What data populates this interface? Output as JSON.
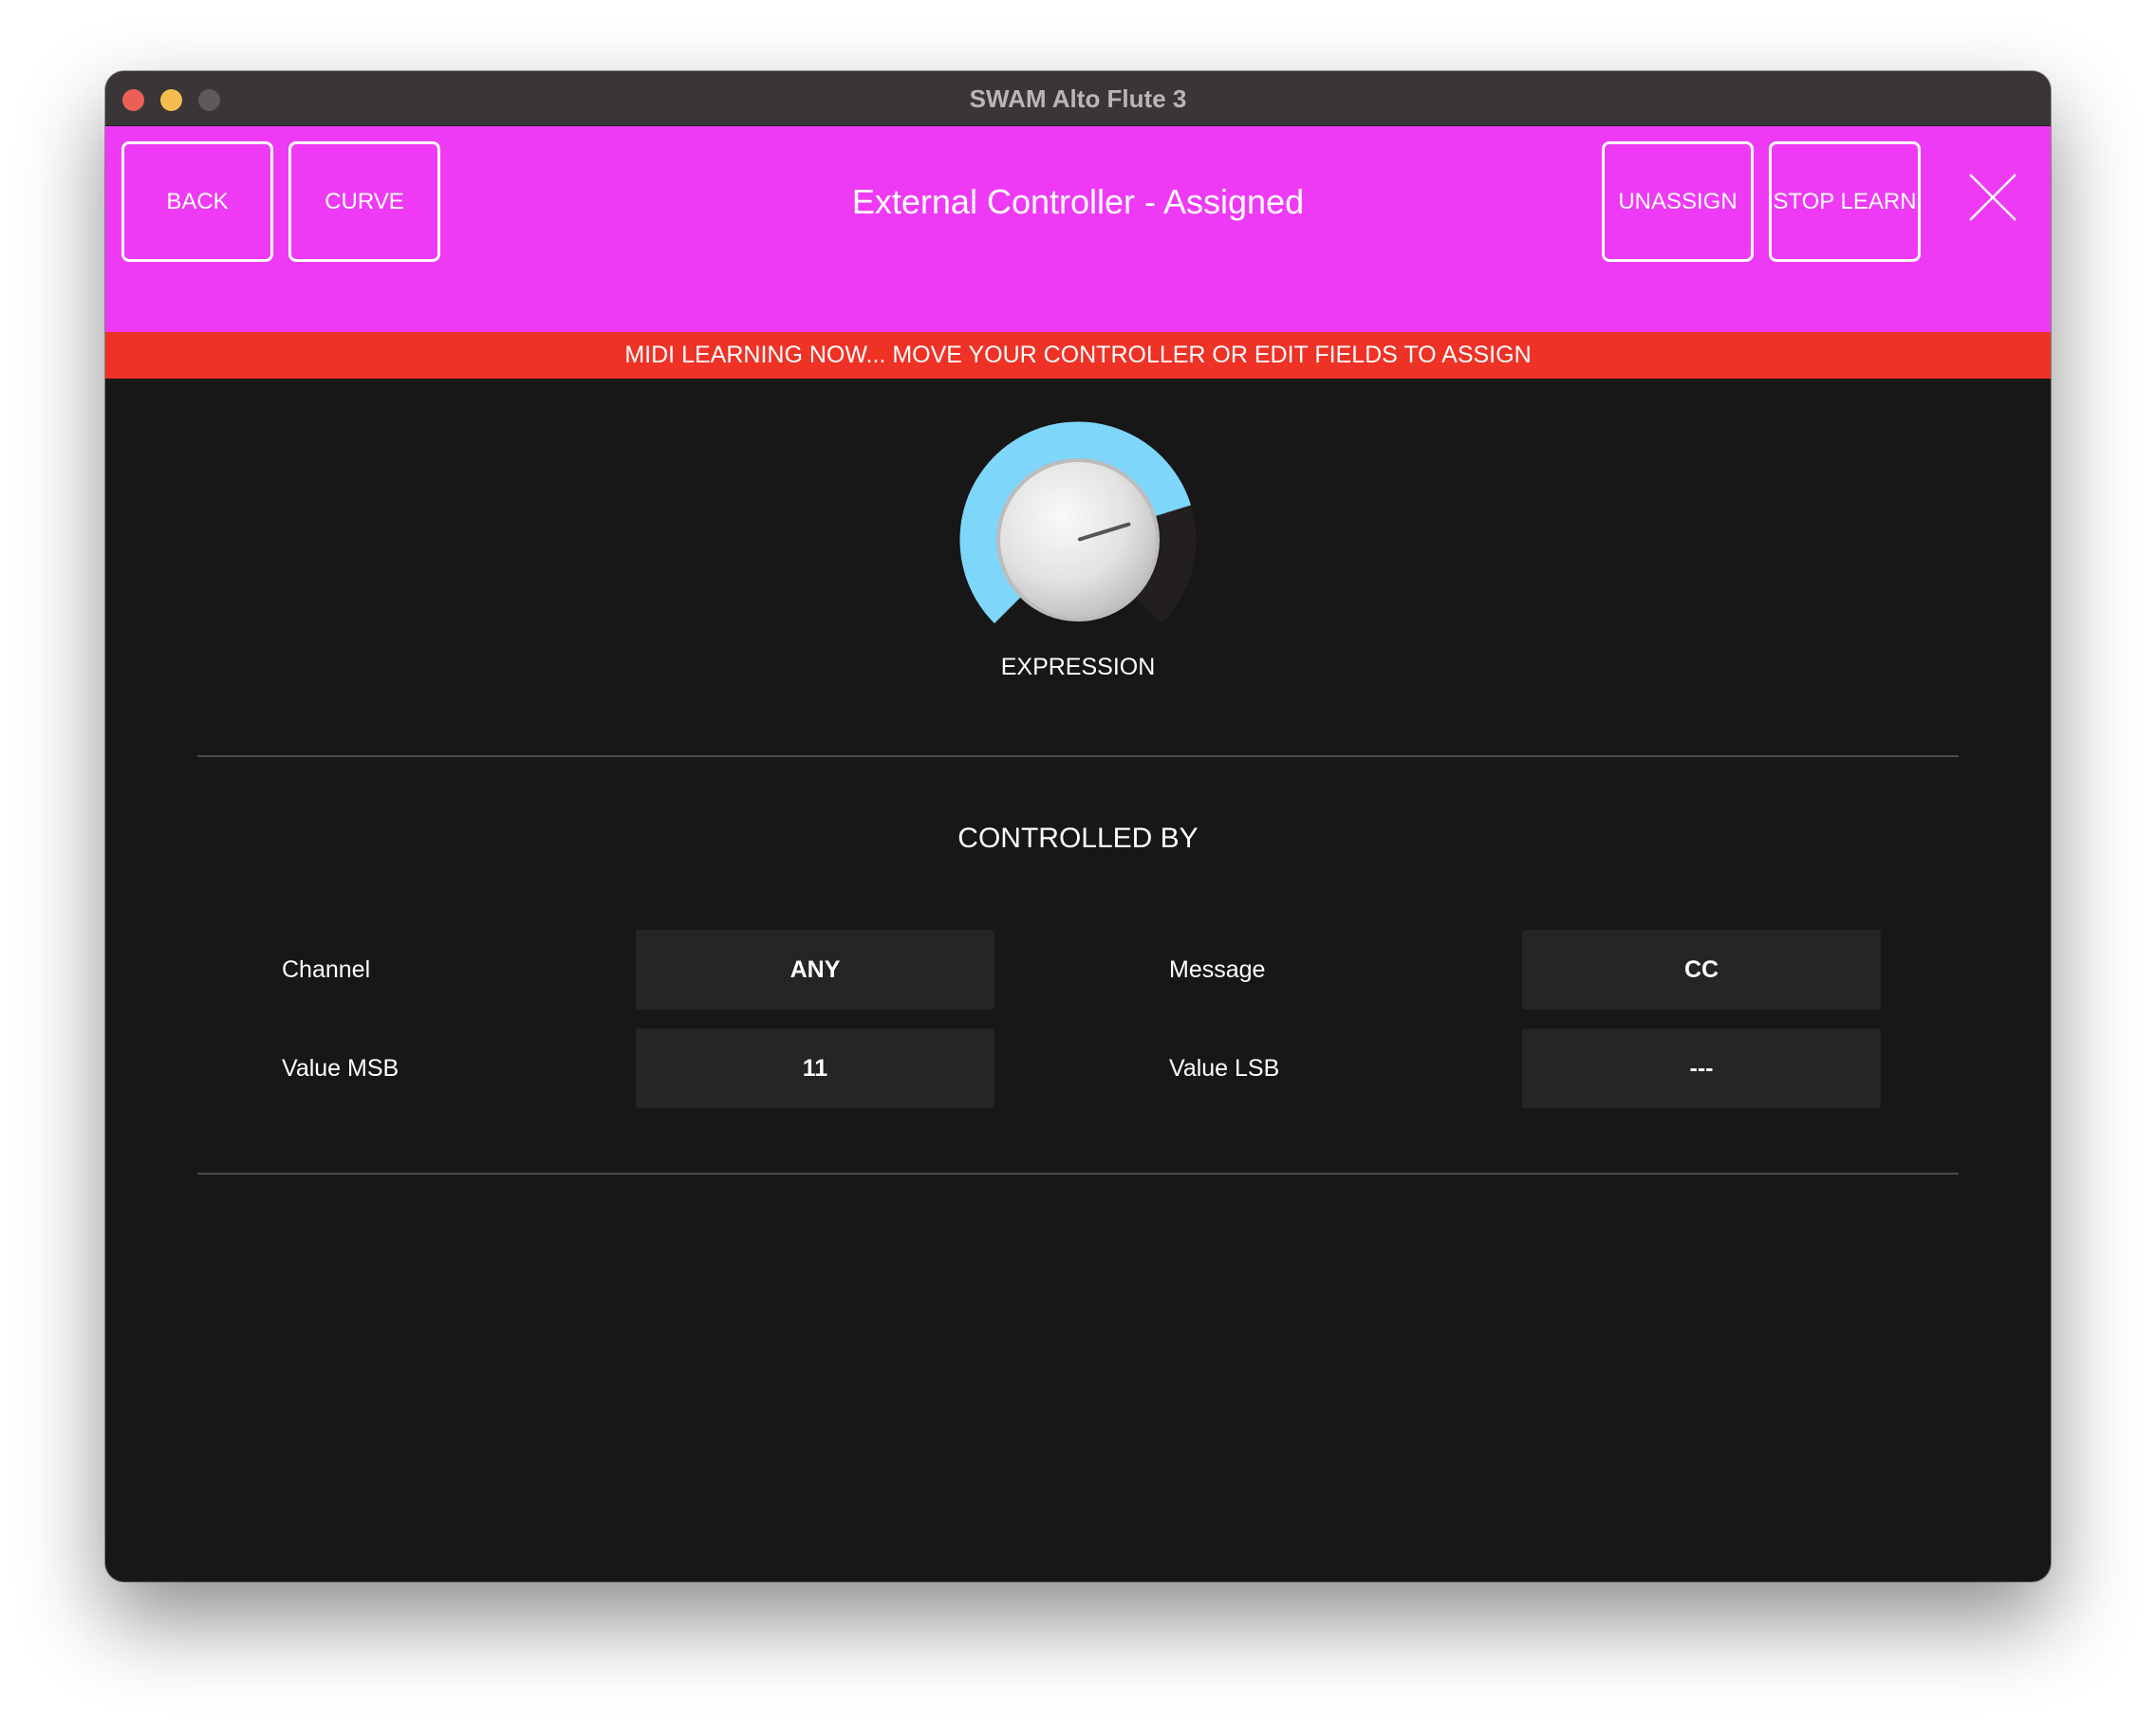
{
  "window": {
    "title": "SWAM Alto Flute 3"
  },
  "header": {
    "back_label": "BACK",
    "curve_label": "CURVE",
    "title": "External Controller - Assigned",
    "unassign_label": "UNASSIGN",
    "stop_learn_label": "STOP LEARN",
    "close_icon": "close-icon",
    "color": "#ee3af5"
  },
  "banner": {
    "text": "MIDI LEARNING NOW... MOVE YOUR CONTROLLER OR EDIT FIELDS TO ASSIGN",
    "color": "#ee3226"
  },
  "knob": {
    "label": "EXPRESSION",
    "value_fraction": 0.77,
    "accent_color": "#7fd6fb"
  },
  "controlled_by": {
    "title": "CONTROLLED BY",
    "fields": {
      "channel": {
        "label": "Channel",
        "value": "ANY"
      },
      "message": {
        "label": "Message",
        "value": "CC"
      },
      "value_msb": {
        "label": "Value MSB",
        "value": "11"
      },
      "value_lsb": {
        "label": "Value LSB",
        "value": "---"
      }
    }
  }
}
